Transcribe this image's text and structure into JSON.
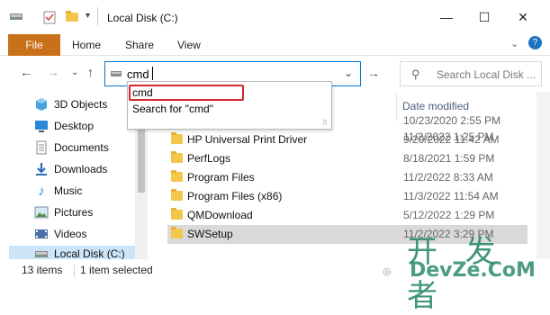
{
  "window": {
    "title": "Local Disk (C:)",
    "controls": [
      "—",
      "☐",
      "✕"
    ]
  },
  "ribbon": {
    "file_tab": "File",
    "tabs": [
      "Home",
      "Share",
      "View"
    ]
  },
  "address_bar": {
    "value": "cmd"
  },
  "autocomplete": {
    "items": [
      "cmd",
      "Search for \"cmd\""
    ]
  },
  "search": {
    "placeholder": "Search Local Disk ..."
  },
  "nav_pane": {
    "items": [
      {
        "label": "3D Objects",
        "icon": "3d-objects-icon"
      },
      {
        "label": "Desktop",
        "icon": "desktop-icon"
      },
      {
        "label": "Documents",
        "icon": "documents-icon"
      },
      {
        "label": "Downloads",
        "icon": "downloads-icon"
      },
      {
        "label": "Music",
        "icon": "music-icon"
      },
      {
        "label": "Pictures",
        "icon": "pictures-icon"
      },
      {
        "label": "Videos",
        "icon": "videos-icon"
      },
      {
        "label": "Local Disk (C:)",
        "icon": "drive-icon",
        "selected": true
      }
    ]
  },
  "file_list": {
    "column_date": "Date modified",
    "rows": [
      {
        "name": "",
        "date": "10/23/2020 2:55 PM"
      },
      {
        "name": "",
        "date": "11/2/2022 1:25 PM"
      },
      {
        "name": "HP Universal Print Driver",
        "date": "9/20/2022 11:42 AM"
      },
      {
        "name": "PerfLogs",
        "date": "8/18/2021 1:59 PM"
      },
      {
        "name": "Program Files",
        "date": "11/2/2022 8:33 AM"
      },
      {
        "name": "Program Files (x86)",
        "date": "11/3/2022 11:54 AM"
      },
      {
        "name": "QMDownload",
        "date": "5/12/2022 1:29 PM"
      },
      {
        "name": "SWSetup",
        "date": "11/2/2022 3:29 PM",
        "selected": true
      }
    ]
  },
  "status_bar": {
    "item_count": "13 items",
    "selection": "1 item selected"
  },
  "watermark": {
    "chinese": "开 发 者",
    "latin": "DevZe.CoM"
  },
  "colors": {
    "file_tab": "#c9701a",
    "accent": "#0078d7",
    "highlight_box": "#d4262b",
    "selected_row": "#d9d9d9",
    "watermark": "#2d8a6e"
  }
}
